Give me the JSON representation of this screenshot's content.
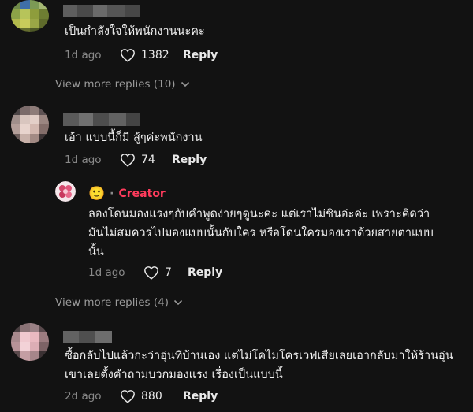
{
  "comments": [
    {
      "text_lines": [
        "เป็นกำลังใจให้พนักงานนะคะ"
      ],
      "age": "1d ago",
      "likes": "1382",
      "reply_label": "Reply",
      "view_more": "View more replies (10)"
    },
    {
      "text_lines": [
        "เอ้า แบบนี้ก็มี สู้ๆค่ะพนักงาน"
      ],
      "age": "1d ago",
      "likes": "74",
      "reply_label": "Reply",
      "creator_reply": {
        "emoji": "🙂",
        "separator": "·",
        "badge": "Creator",
        "text_lines": [
          "ลองโดนมองแรงๆกับคำพูดง่ายๆดูนะคะ แต่เราไม่ชินอ่ะค่ะ เพราะคิดว่า",
          "มันไม่สมควรไปมองแบบนั้นกับใคร หรือโดนใครมองเราด้วยสายตาแบบ",
          "นั้น"
        ],
        "age": "1d ago",
        "likes": "7",
        "reply_label": "Reply"
      },
      "view_more": "View more replies (4)"
    },
    {
      "text_lines": [
        "ซื้อกลับไปแล้วกะว่าอุ่นที่บ้านเอง แต่ไม่โคไมโครเวฟเสียเลยเอากลับมาให้ร้านอุ่น",
        "เขาเลยตั้งคำถามบวกมองแรง เรื่องเป็นแบบนี้"
      ],
      "age": "2d ago",
      "likes": "880",
      "reply_label": "Reply"
    }
  ],
  "colors": {
    "background": "#121212",
    "creator": "#ff3b5c",
    "meta": "#8a8a8a"
  }
}
